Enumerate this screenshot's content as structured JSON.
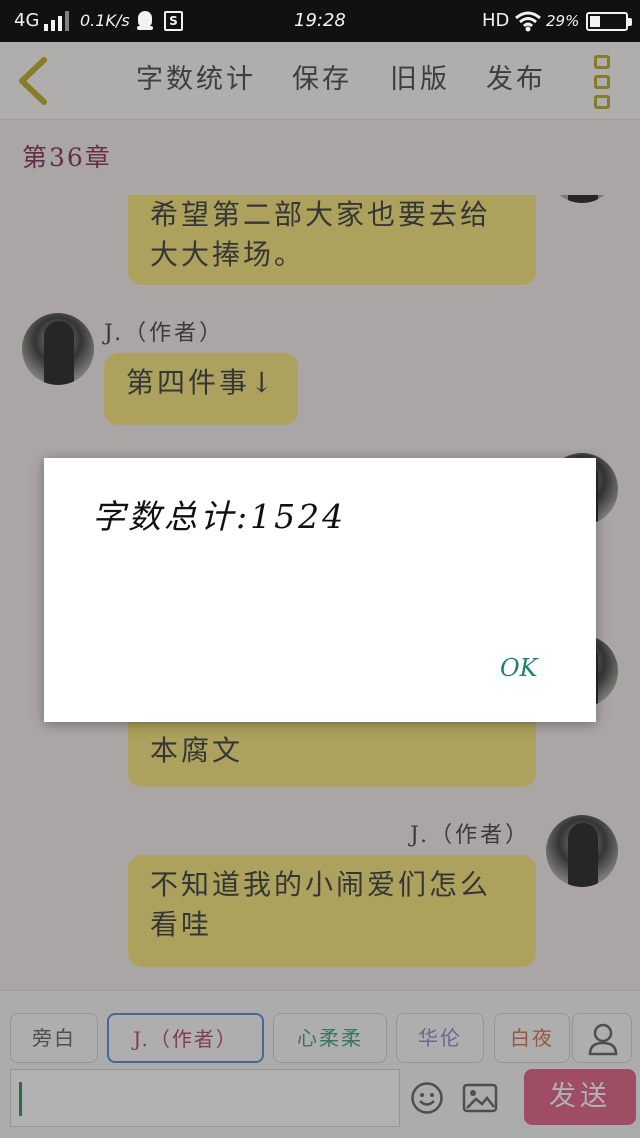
{
  "status_bar": {
    "network": "4G",
    "speed": "0.1K/s",
    "s_badge": "S",
    "time": "19:28",
    "hd": "HD",
    "battery": "29%",
    "battery_level": 0.29
  },
  "toolbar": {
    "word_count": "字数统计",
    "save": "保存",
    "old_version": "旧版",
    "publish": "发布"
  },
  "chapter_title": "第36章",
  "messages": [
    {
      "side": "right",
      "lines": [
        "希望第二部大家也要去给",
        "大大捧场。"
      ]
    },
    {
      "side": "left",
      "sender": "J.（作者）",
      "lines": [
        "第四件事↓"
      ]
    },
    {
      "side": "right",
      "lines": [
        "本腐文"
      ]
    },
    {
      "side": "right",
      "sender": "J.（作者）",
      "lines": [
        "不知道我的小闹爱们怎么",
        "看哇"
      ]
    }
  ],
  "characters": [
    {
      "label": "旁白",
      "color": "#555555",
      "active": false
    },
    {
      "label": "J.（作者）",
      "color": "#b0355f",
      "active": true
    },
    {
      "label": "心柔柔",
      "color": "#2e9a6e",
      "active": false
    },
    {
      "label": "华伦",
      "color": "#8a7cc0",
      "active": false
    },
    {
      "label": "白夜",
      "color": "#d06a34",
      "active": false
    }
  ],
  "input": {
    "value": ""
  },
  "send_label": "发送",
  "dialog": {
    "message": "字数总计:1524",
    "ok_label": "OK"
  }
}
